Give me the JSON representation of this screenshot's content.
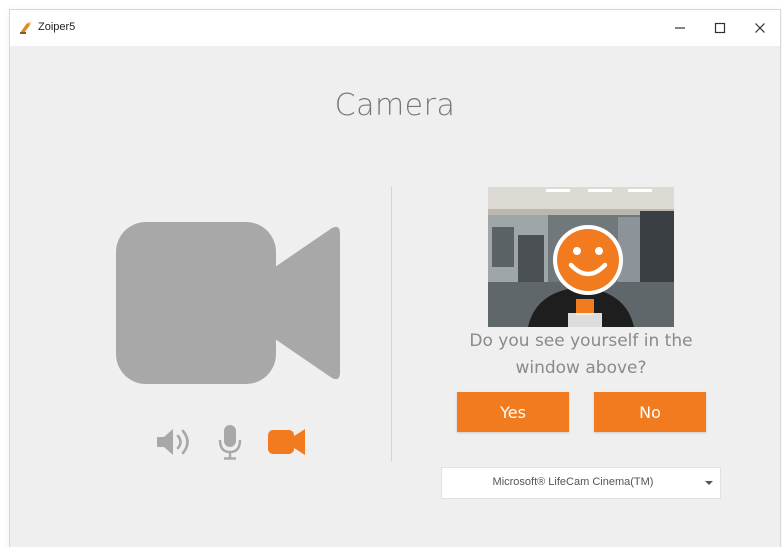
{
  "window": {
    "title": "Zoiper5",
    "controls": {
      "minimize": "minimize",
      "maximize": "maximize",
      "close": "close"
    }
  },
  "page": {
    "title": "Camera"
  },
  "camera_test": {
    "question": "Do you see yourself in the window above?",
    "yes_label": "Yes",
    "no_label": "No"
  },
  "device_select": {
    "selected": "Microsoft® LifeCam Cinema(TM)"
  },
  "icons": {
    "big": "video-camera-icon",
    "speaker": "speaker-icon",
    "microphone": "microphone-icon",
    "camera": "video-camera-icon"
  },
  "colors": {
    "accent": "#f27b20",
    "icon_gray": "#a8a8a9",
    "text_gray": "#8a8a8a",
    "background": "#efefef"
  }
}
